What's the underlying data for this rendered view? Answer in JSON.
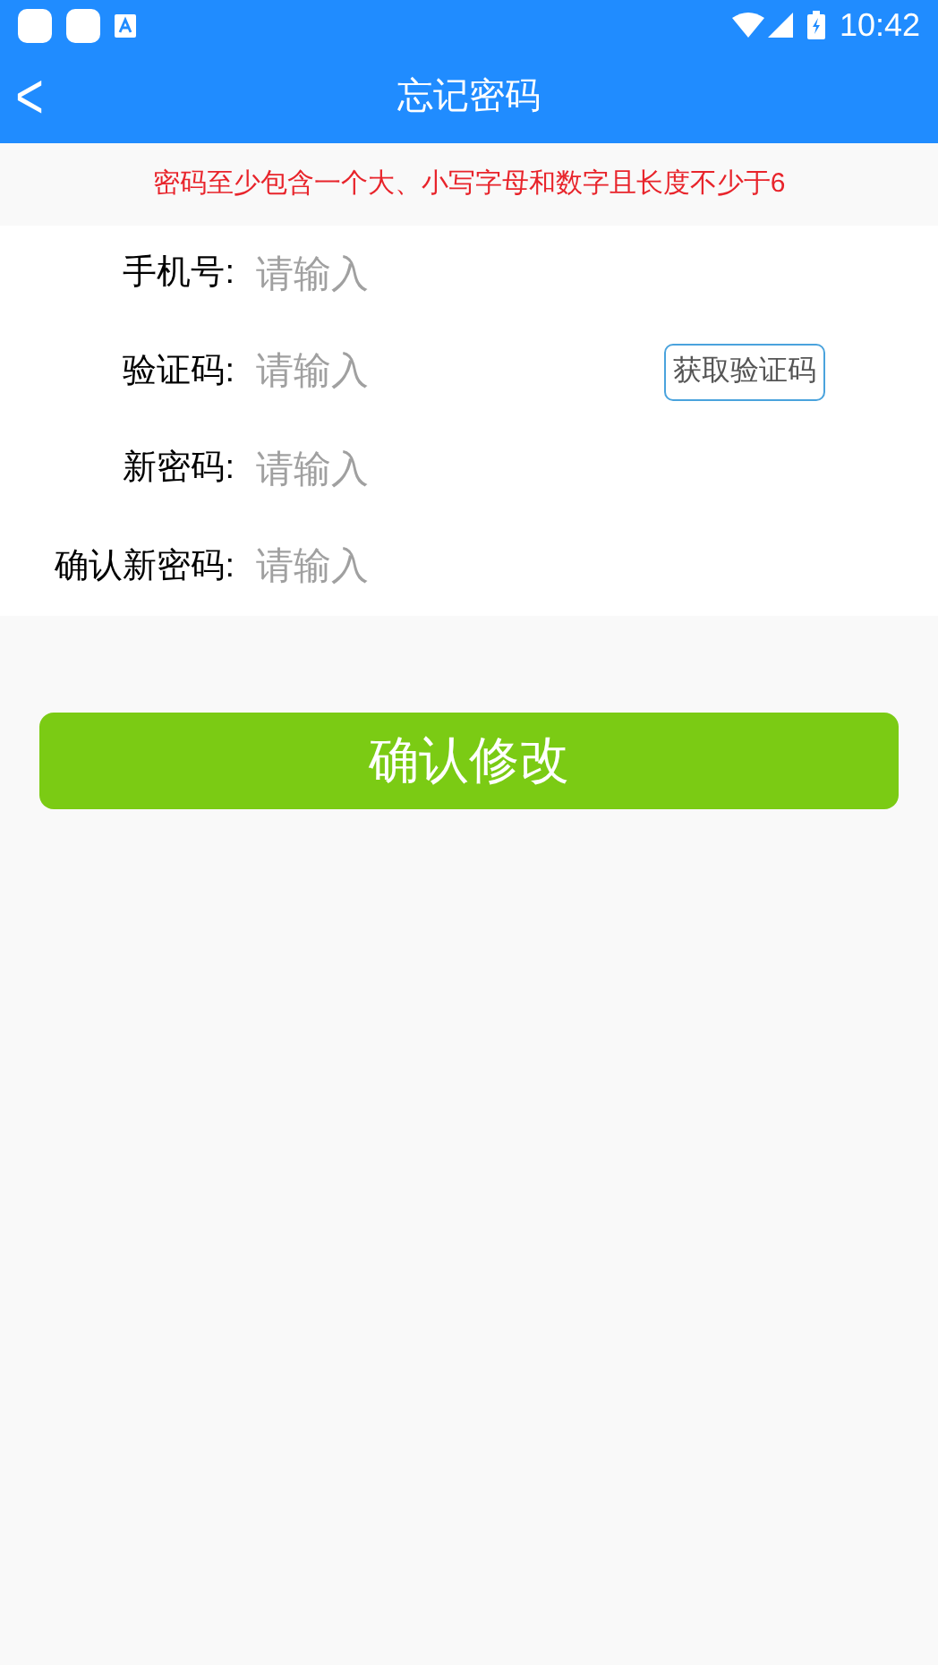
{
  "status_bar": {
    "time": "10:42"
  },
  "header": {
    "back": "<",
    "title": "忘记密码"
  },
  "hint": "密码至少包含一个大、小写字母和数字且长度不少于6",
  "fields": [
    {
      "label": "手机号:",
      "placeholder": "请输入"
    },
    {
      "label": "验证码:",
      "placeholder": "请输入",
      "action": "获取验证码"
    },
    {
      "label": "新密码:",
      "placeholder": "请输入"
    },
    {
      "label": "确认新密码:",
      "placeholder": "请输入"
    }
  ],
  "submit": "确认修改"
}
